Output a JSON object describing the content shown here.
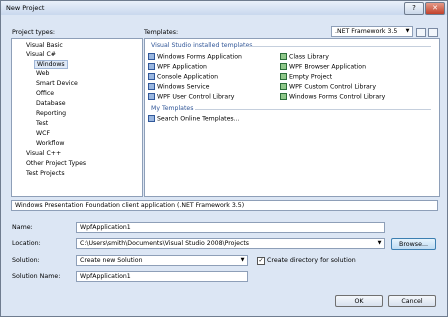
{
  "window": {
    "title": "New Project",
    "help": "?",
    "close": "✕"
  },
  "labels": {
    "project_types": "Project types:",
    "templates": "Templates:"
  },
  "framework": {
    "value": ".NET Framework 3.5"
  },
  "tree": [
    "Visual Basic",
    "Visual C#",
    "Windows",
    "Web",
    "Smart Device",
    "Office",
    "Database",
    "Reporting",
    "Test",
    "WCF",
    "Workflow",
    "Visual C++",
    "Other Project Types",
    "Test Projects"
  ],
  "sections": {
    "installed": "Visual Studio installed templates",
    "my": "My Templates"
  },
  "templates_left": [
    "Windows Forms Application",
    "WPF Application",
    "Console Application",
    "Windows Service",
    "WPF User Control Library"
  ],
  "templates_right": [
    "Class Library",
    "WPF Browser Application",
    "Empty Project",
    "WPF Custom Control Library",
    "Windows Forms Control Library"
  ],
  "search_online": "Search Online Templates...",
  "description": "Windows Presentation Foundation client application (.NET Framework 3.5)",
  "form": {
    "name_label": "Name:",
    "name_value": "WpfApplication1",
    "location_label": "Location:",
    "location_value": "C:\\Users\\smith\\Documents\\Visual Studio 2008\\Projects",
    "browse": "Browse...",
    "solution_label": "Solution:",
    "solution_value": "Create new Solution",
    "create_dir": "Create directory for solution",
    "solution_name_label": "Solution Name:",
    "solution_name_value": "WpfApplication1"
  },
  "buttons": {
    "ok": "OK",
    "cancel": "Cancel"
  }
}
